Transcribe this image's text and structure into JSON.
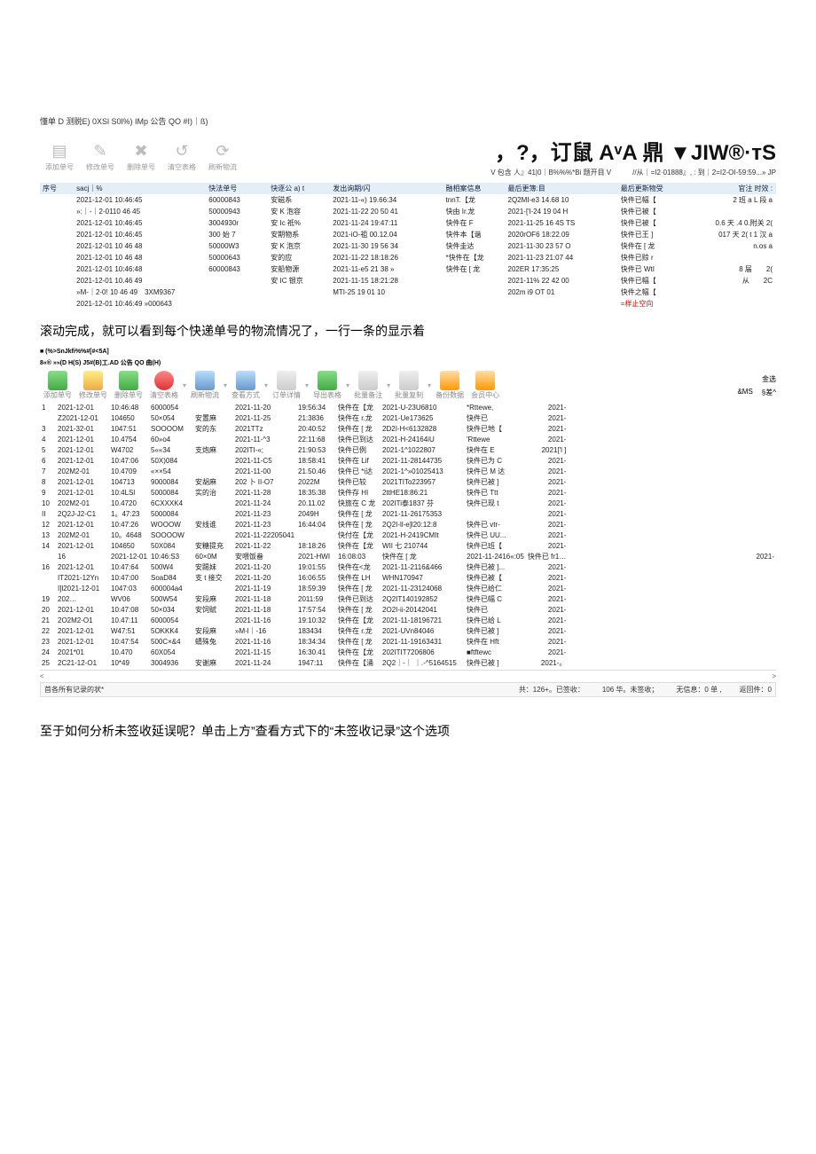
{
  "top_caption": "懂单 D 测脱E) 0XSl S0l%) IMp 公告 QO #I)｜ß)",
  "header_right_big": "，?，订鼠 AᵛA 鼎 ▼JIW®·ᴛS",
  "header_right_sub": "V 包含 人』41|0｜B%%%*Bi 题开目 V　　　//从｜=I2·01888』,  : 到｜2=I2-OI-59:59...» JP",
  "toolbar1": [
    {
      "label": "添加单号",
      "ico": "📄"
    },
    {
      "label": "修改单号",
      "ico": "✏️"
    },
    {
      "label": "删除单号",
      "ico": "✖"
    },
    {
      "label": "清空表格",
      "ico": "🔄"
    },
    {
      "label": "刷新物流",
      "ico": "⟳"
    }
  ],
  "table1": {
    "headers": [
      "序号",
      "sacj｜%",
      "快法单号",
      "快逐公 a) t",
      "发出询期/闪",
      "融相案信息",
      "最后更簿:目",
      "最后更斯物受",
      "官注 时效 :"
    ],
    "rows": [
      [
        "",
        "2021-12-01 10:46:45",
        "60000843",
        "安磁系",
        "2021-11-«) 19.66:34",
        "tnnT.【龙",
        "2Q2MI-e3 14.68 10",
        "快件已幅【",
        "2 班 a L 段 a"
      ],
      [
        "",
        "»:｜-｜2-0110 46 45",
        "50000943",
        "安 K 泡容",
        "2021-11-22 20 50 41",
        "快由 Ir.龙",
        "2021-['l-24 19 04 H",
        "快件已被【",
        ""
      ],
      [
        "",
        "2021-12-01 10:46:45",
        "3004930r",
        "安 Ic 祗%",
        "2021-11-24 19:47:11",
        "快件在 F",
        "2021-11-25 16 4S TS",
        "快件已被【",
        "0.6 天 .4 0.附关 2("
      ],
      [
        "",
        "2021-12-01 10:46:45",
        "300 始 7",
        "安期物系",
        "2021-iO-祖 00.12.04",
        "快件本【谐",
        "2020rOF6 18:22.09",
        "快件已王 ]",
        "017 天 2( t 1 汉 a"
      ],
      [
        "",
        "2021-12-01 10 46 48",
        "50000W3",
        "安 K 泡京",
        "2021-11-30 19 56 34",
        "快件圭达",
        "2021-11-30 23 57 O",
        "快件在 [ 龙",
        "n.os a"
      ],
      [
        "",
        "2021-12-01 10 46 48",
        "50000643",
        "安的应",
        "2021-11-22 18:18:26",
        "*快件在【龙",
        "2021-11-23 21:07 44",
        "快件已赊 r",
        ""
      ],
      [
        "",
        "2021-12-01 10:46:48",
        "60000843",
        "安船物源",
        "2021-11-e5 21 38 »",
        "快件在 [ 龙",
        "202ER 17:35:25",
        "快件已 WtI",
        "8 届　　2("
      ],
      [
        "",
        "2021-12-01 10.46 49",
        "",
        "安 IC 银京",
        "2021-11-15 18:21:28",
        "",
        "2021-11% 22 42 00",
        "快件已幅【",
        "从　　2C"
      ],
      [
        "",
        "»M-｜2-0! 10 46 49　3XM9367",
        "",
        "",
        "MTI-25 19 01 10",
        "",
        "202m i9 OT 01",
        "快件之幅【",
        ""
      ],
      [
        "",
        "2021-12-01 10:46:49 »000643",
        "",
        "",
        "",
        "",
        "",
        "=样止空向",
        ""
      ]
    ]
  },
  "desc1": "滚动完成，就可以看到每个快递单号的物流情况了，一行一条的显示着",
  "code1": "■ (%>SnJkfi%%#[#<5A]",
  "code2": "8«® »»(D H(S) J5#(B)工.AD 公告 QO 曲(H)",
  "toolbar2": [
    {
      "label": "添加单号",
      "cls": "ic-green"
    },
    {
      "label": "修改单号",
      "cls": "ic-yellow"
    },
    {
      "label": "删除单号",
      "cls": "ic-green"
    },
    {
      "label": "清空表格",
      "cls": "ic-red"
    },
    {
      "label": "刷新物流",
      "cls": "ic-blue"
    },
    {
      "label": "查看方式",
      "cls": "ic-blue"
    },
    {
      "label": "订单详情",
      "cls": "ic-gray"
    },
    {
      "label": "导出表格",
      "cls": "ic-green"
    },
    {
      "label": "批量备注",
      "cls": "ic-gray"
    },
    {
      "label": "批量复制",
      "cls": "ic-gray"
    },
    {
      "label": "备份数据",
      "cls": "ic-orange"
    },
    {
      "label": "会员中心",
      "cls": "ic-orange"
    }
  ],
  "right_header": {
    "a": "金选",
    "b": "&MS",
    "c": "§差^"
  },
  "table2": {
    "rows": [
      [
        "1",
        "2021-12-01",
        "10:46:48",
        "6000054",
        "",
        "2021-11-20",
        "19:56:34",
        "快件在【龙",
        "2021-U-23U6810",
        "*Rttewe,",
        "2021-"
      ],
      [
        "",
        "Z2021-12-01",
        "104650",
        "50×054",
        "安置麻",
        "2021-11-25",
        "21:3836",
        "快件在 r.龙",
        "2021-Ue173625",
        "快件已",
        "2021-"
      ],
      [
        "3",
        "2021-32-01",
        "1047:51",
        "SOOOOM",
        "安的东",
        "2021TTz",
        "20:40:52",
        "快件在 [ 龙",
        "2D2I-H<6132828",
        "快件已地【",
        "2021-"
      ],
      [
        "4",
        "2021-12-01",
        "10.4754",
        "60»o4",
        "",
        "2021-11-^3",
        "22:11:68",
        "快件已到达",
        "2021-H-24164iU",
        "'Rttewe",
        "2021-"
      ],
      [
        "5",
        "2021-12-01",
        "W4702",
        "5««34",
        "支炮麻",
        "202ITI-«;",
        "21:90:53",
        "快件已例",
        "2021-1^1022807",
        "快件在 E",
        "2021['l ]"
      ],
      [
        "6",
        "2021-12-01",
        "10:47:06",
        "50X)084",
        "",
        "2021-11-C5",
        "18:58:41",
        "快件在 Lif",
        "2021-11-28144735",
        "快件已为 C",
        "2021-"
      ],
      [
        "7",
        "202M2-01",
        "10.4709",
        "«××54",
        "",
        "2021-11-00",
        "21.50.46",
        "快件已 *i达",
        "2021-1^»01025413",
        "快件已 M 达",
        "2021-"
      ],
      [
        "8",
        "2021-12-01",
        "104713",
        "9000084",
        "安胡麻",
        "202 卜 II-O7",
        "2022M",
        "快件已较",
        "2021TITo223957",
        "快件已被 ]",
        "2021-"
      ],
      [
        "9",
        "2021-12-01",
        "10:4LSl",
        "5000084",
        "实的治",
        "2021-11-28",
        "18:35:38",
        "快件存 HI",
        "2ttHE18:86:21",
        "快件已 Ttt",
        "2021-"
      ],
      [
        "10",
        "202M2-01",
        "10.4720",
        "6CXXXK4",
        "",
        "2021-11-24",
        "20.11.02",
        "快旅在 C 龙",
        "202ITi泰1837 芬",
        "快件已现 t",
        "2021-"
      ],
      [
        "II",
        "2Q2J-J2-C1",
        "1。47:23",
        "5000084",
        "",
        "2021-11-23",
        "2049H",
        "快件在 [ 龙",
        "2021-11-26175353",
        "",
        "2021-"
      ],
      [
        "12",
        "2021-12-01",
        "10:47:26",
        "WOOOW",
        "安线谁",
        "2021-11-23",
        "16:44:04",
        "快件在 [ 龙",
        "2Q2I-ll-e]l20:12:8",
        "快件已 vtr-",
        "2021-"
      ],
      [
        "13",
        "202M2-01",
        "10。4648",
        "SOOOOW",
        "",
        "2021-11-22205041",
        "",
        "快付在【龙",
        "2021-H-2419CMIt",
        "快件已 UU...",
        "2021-"
      ],
      [
        "14",
        "2021-12-01",
        "104650",
        "50X084",
        "安糖提充",
        "2021-11-22",
        "18:18:26",
        "快件在【龙",
        "WII 七 210744",
        "快件已班【",
        "2021-"
      ],
      [
        "",
        "16",
        "2021-12-01",
        "10:46:S3",
        "60×0M",
        "安喂饭畚",
        "2021-HWI",
        "16:08:03",
        "快件在 [ 龙",
        "2021-11-2416«:05",
        "快件已 fr1…",
        "2021-"
      ],
      [
        "16",
        "2021-12-01",
        "10:47:64",
        "500W4",
        "安踢妹",
        "2021-11-20",
        "19:01:55",
        "快件在<龙",
        "2021-11-2116&466",
        "快件已被 ]...",
        "2021-"
      ],
      [
        "",
        "IT2021-12Yn",
        "10:47:00",
        "SoaD84",
        "支 t 接交",
        "2021-11-20",
        "16:06:55",
        "快件在 LH",
        "WHN170947",
        "快件已被【",
        "2021-"
      ],
      [
        "",
        "I]l2021-12-01",
        "1047:03",
        "600004a4",
        "",
        "2021-11-19",
        "18:59:39",
        "快件在 [ 龙",
        "2021-11-23124068",
        "快件已给仁",
        "2021-"
      ],
      [
        "19",
        "202…",
        "WV06",
        "500W54",
        "安段麻",
        "2021-11-18",
        "2011:59",
        "快件已到达",
        "2Q2IT140192852",
        "快件已幅 C",
        "2021-"
      ],
      [
        "20",
        "2021-12-01",
        "10:47:08",
        "50×034",
        "安饲赋",
        "2021-11-18",
        "17:57:54",
        "快件在 [ 龙",
        "2O2I-ii-20142041",
        "快件已",
        "2021-"
      ],
      [
        "21",
        "2O2M2-O1",
        "10.47:11",
        "6000054",
        "",
        "2021-11-16",
        "19:10:32",
        "快件在【龙",
        "2021-11-18196721",
        "快件已给 L",
        "2021-"
      ],
      [
        "22",
        "2021-12-01",
        "W47:51",
        "5OKKK4",
        "安段麻",
        "»M-l｜-16",
        "183434",
        "快件在 r.龙",
        "2021-UVn84046",
        "快件已被 ]",
        "2021-"
      ],
      [
        "23",
        "2021-12-01",
        "10:47:54",
        "500C×&4",
        "蜻殊兔",
        "2021-11-16",
        "18:34:34",
        "快件在 [ 龙",
        "2021-11-19163431",
        "快件在 Hft",
        "2021-"
      ],
      [
        "24",
        "2021*01",
        "10.470",
        "60X054",
        "",
        "2021-11-15",
        "16:30.41",
        "快件在【龙",
        "202ITIT7206806",
        "■ftftewc",
        "2021-"
      ],
      [
        "25",
        "2C21-12-O1",
        "10*49",
        "3004936",
        "安谢麻",
        "2021-11-24",
        "1947:11",
        "快件在【涌",
        "2Q2｜-｜ ｜.-^5164515",
        "快件已被 ]",
        "2021-。"
      ]
    ]
  },
  "scroll_label": {
    "left": "<",
    "right": ">"
  },
  "statusbar": {
    "left": "首各所有记录的状*",
    "mid1": "共：126+。已签收：",
    "mid2": "106 华。未签收；",
    "mid3": "无信息：0 单 ,",
    "right": "返回件：0"
  },
  "desc2": "至于如何分析未签收延误呢？单击上方”查看方式下的“未签收记录”这个选项"
}
